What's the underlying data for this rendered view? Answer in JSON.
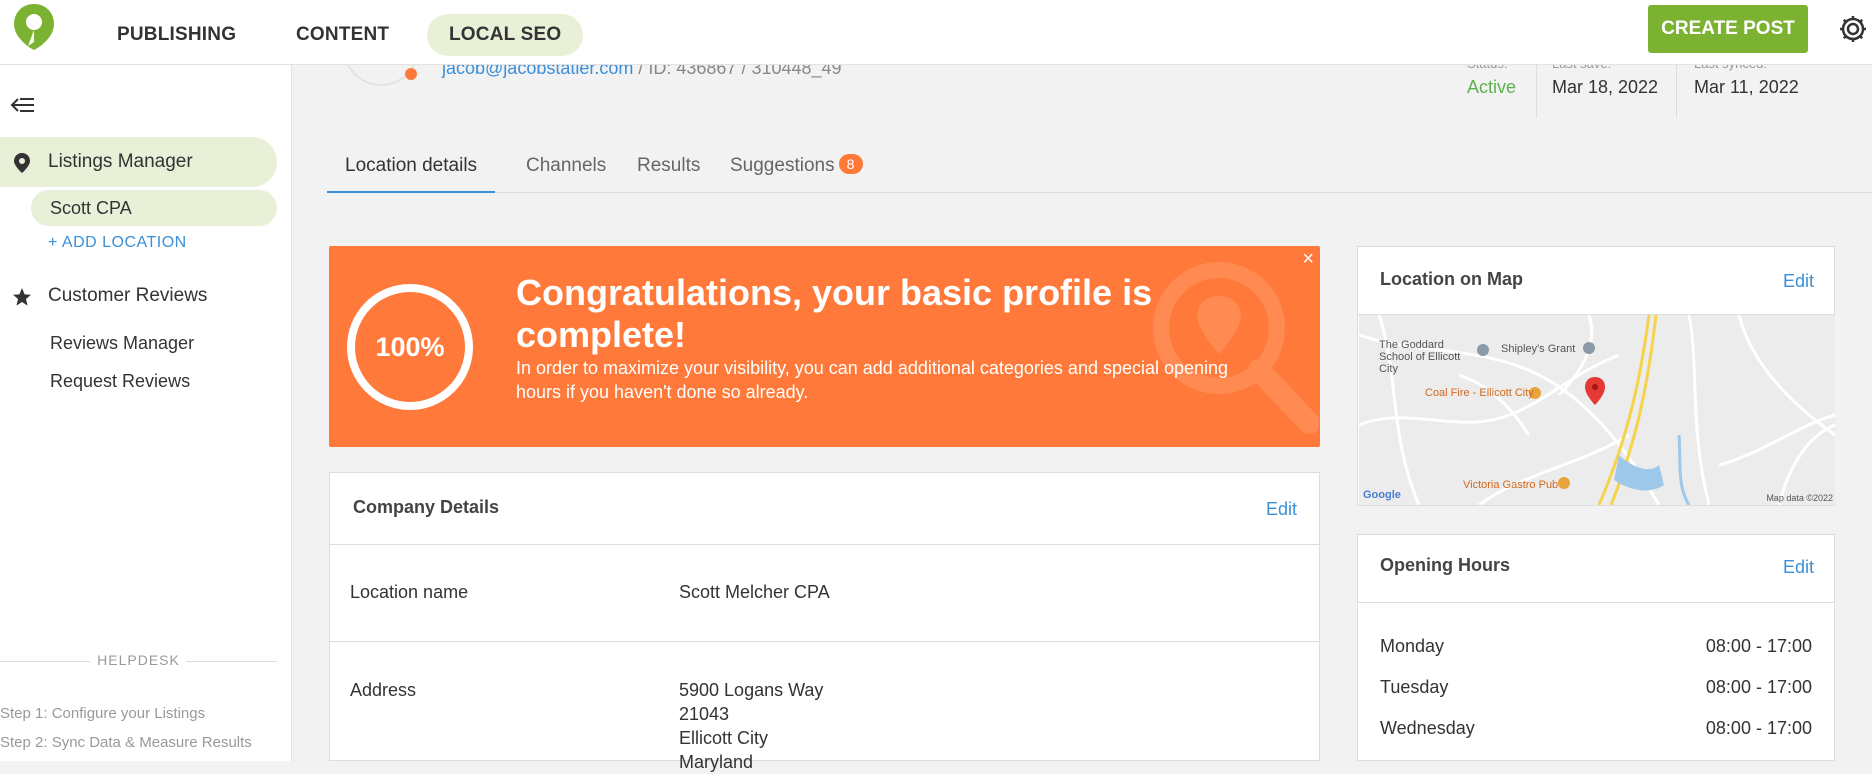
{
  "nav": {
    "items": [
      "PUBLISHING",
      "CONTENT",
      "LOCAL SEO"
    ],
    "active": "LOCAL SEO",
    "create_post": "CREATE POST",
    "brand_color": "#7cb232"
  },
  "sidebar": {
    "listings_manager": "Listings Manager",
    "location": "Scott CPA",
    "add_location": "+ ADD LOCATION",
    "customer_reviews": "Customer Reviews",
    "reviews_manager": "Reviews Manager",
    "request_reviews": "Request Reviews",
    "helpdesk": "HELPDESK",
    "steps": [
      "Step 1: Configure your Listings",
      "Step 2: Sync Data & Measure Results"
    ]
  },
  "header": {
    "email": "jacob@jacobstatler.com",
    "id_text": " / ID: 436867 / 310448_49",
    "status_label": "Status:",
    "status_value": "Active",
    "last_save_label": "Last save:",
    "last_save_value": "Mar 18, 2022",
    "last_synced_label": "Last synced:",
    "last_synced_value": "Mar 11, 2022"
  },
  "tabs": [
    {
      "label": "Location details",
      "active": true
    },
    {
      "label": "Channels"
    },
    {
      "label": "Results"
    },
    {
      "label": "Suggestions",
      "badge": "8"
    }
  ],
  "banner": {
    "percent": "100%",
    "progress": 1.0,
    "title": "Congratulations, your basic profile is complete!",
    "description": "In order to maximize your visibility, you can add additional categories and special opening hours if you haven't done so already.",
    "close": "×",
    "color": "#ff7a3a"
  },
  "company": {
    "title": "Company Details",
    "edit": "Edit",
    "location_name_label": "Location name",
    "location_name": "Scott Melcher CPA",
    "address_label": "Address",
    "address_lines": [
      "5900 Logans Way",
      "21043",
      "Ellicott City",
      "Maryland"
    ]
  },
  "map_card": {
    "title": "Location on Map",
    "edit": "Edit",
    "labels": {
      "school": "The Goddard School of Ellicott City",
      "shipley": "Shipley's Grant",
      "coal_fire": "Coal Fire - Ellicott City",
      "victoria": "Victoria Gastro Pub",
      "google": "Google",
      "map_data": "Map data ©2022"
    }
  },
  "hours": {
    "title": "Opening Hours",
    "edit": "Edit",
    "rows": [
      {
        "day": "Monday",
        "time": "08:00 - 17:00"
      },
      {
        "day": "Tuesday",
        "time": "08:00 - 17:00"
      },
      {
        "day": "Wednesday",
        "time": "08:00 - 17:00"
      }
    ]
  }
}
